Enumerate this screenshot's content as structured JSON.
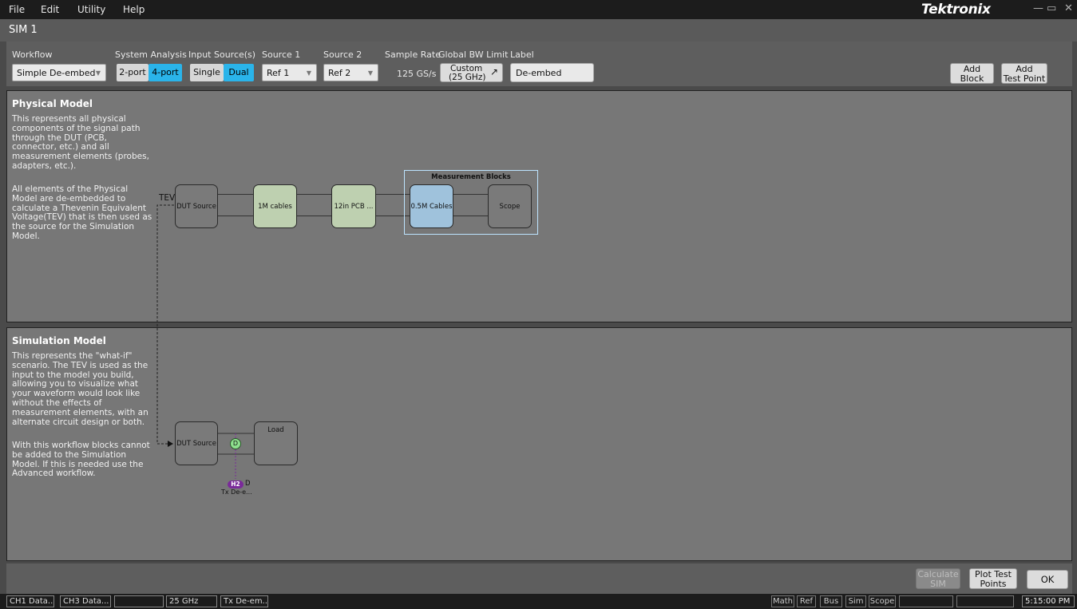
{
  "menu": {
    "items": [
      "File",
      "Edit",
      "Utility",
      "Help"
    ],
    "brand": "Tektronix"
  },
  "title": "SIM 1",
  "config": {
    "workflow_label": "Workflow",
    "workflow_value": "Simple De-embed",
    "system_analysis_label": "System Analysis",
    "system_analysis_options": [
      "2-port",
      "4-port"
    ],
    "system_analysis_selected": "4-port",
    "input_sources_label": "Input Source(s)",
    "input_sources_options": [
      "Single",
      "Dual"
    ],
    "input_sources_selected": "Dual",
    "source1_label": "Source 1",
    "source1_value": "Ref 1",
    "source2_label": "Source 2",
    "source2_value": "Ref 2",
    "sample_rate_label": "Sample Rate",
    "sample_rate_value": "125 GS/s",
    "bw_limit_label": "Global BW Limit",
    "bw_limit_line1": "Custom",
    "bw_limit_line2": "(25 GHz)",
    "label_label": "Label",
    "label_value": "De-embed",
    "add_block_line1": "Add",
    "add_block_line2": "Block",
    "add_tp_line1": "Add",
    "add_tp_line2": "Test Point"
  },
  "physical": {
    "title": "Physical Model",
    "desc1": "This represents all physical components of the signal path through the DUT (PCB, connector, etc.) and all measurement elements (probes, adapters, etc.).",
    "desc2": "All elements of the Physical Model are de-embedded to calculate a Thevenin Equivalent Voltage(TEV) that is then used as the source for the Simulation Model.",
    "tev_label": "TEV",
    "measurement_title": "Measurement Blocks",
    "blocks": [
      "DUT Source",
      "1M cables",
      "12in PCB ...",
      "0.5M Cables",
      "Scope"
    ]
  },
  "simulation": {
    "title": "Simulation Model",
    "desc1": "This represents the \"what-if\" scenario. The TEV is used as the input to the model you build, allowing you to visualize what your waveform would look like without the effects of measurement elements, with an alternate circuit design or both.",
    "desc2": "With this workflow blocks cannot be added to the Simulation Model. If this is needed use the Advanced workflow.",
    "source_block": "DUT Source",
    "load_block": "Load",
    "test_point": "D",
    "badge": "H2",
    "badge_suffix": "D",
    "badge_caption": "Tx De-e..."
  },
  "actions": {
    "calculate_line1": "Calculate",
    "calculate_line2": "SIM",
    "plot_line1": "Plot Test",
    "plot_line2": "Points",
    "ok": "OK"
  },
  "status": {
    "cells": [
      "CH1 Data...",
      "CH3 Data...",
      "",
      "25 GHz",
      "Tx De-em..."
    ],
    "buttons": [
      "Math",
      "Ref",
      "Bus",
      "Sim",
      "Scope"
    ],
    "time": "5:15:00 PM"
  },
  "colors": {
    "accent": "#2ab4ea",
    "green_block": "#bed0b0",
    "blue_block": "#9fc2dc",
    "badge": "#7a2a9a",
    "test_point": "#8ee08e"
  }
}
